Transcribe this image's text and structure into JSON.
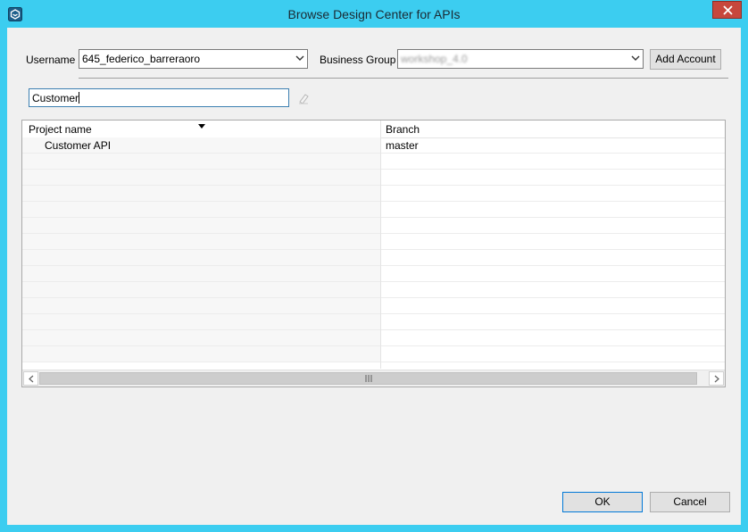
{
  "window": {
    "title": "Browse Design Center for APIs",
    "accent_color": "#3ccdf0",
    "close_color": "#c7473c",
    "app_icon": "anypoint-icon"
  },
  "form": {
    "username_label": "Username",
    "username_value": "645_federico_barreraoro",
    "business_group_label": "Business Group",
    "business_group_value": "workshop_4.0",
    "add_account_label": "Add Account",
    "search_value": "Customer"
  },
  "table": {
    "columns": [
      "Project name",
      "Branch"
    ],
    "sort_indicator": "sort-descending-icon",
    "rows": [
      {
        "project": "Customer API",
        "branch": "master"
      }
    ]
  },
  "footer": {
    "ok_label": "OK",
    "cancel_label": "Cancel"
  }
}
